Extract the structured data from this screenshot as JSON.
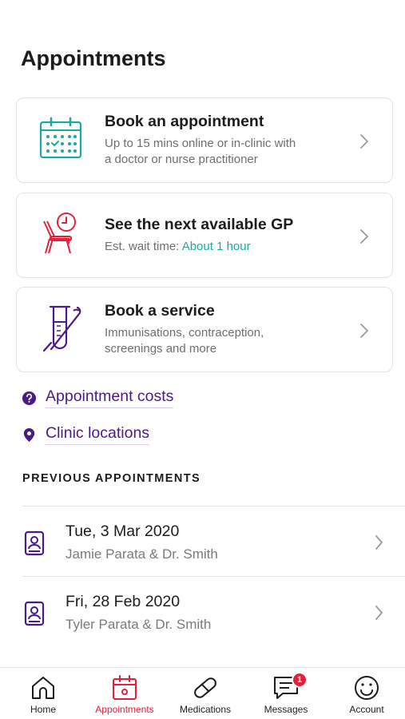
{
  "page": {
    "title": "Appointments"
  },
  "cards": [
    {
      "title": "Book an appointment",
      "subtitle_line1": "Up to 15 mins online or in-clinic with",
      "subtitle_line2": "a doctor or nurse practitioner",
      "icon": "calendar-icon",
      "icon_color": "#1aa8a0"
    },
    {
      "title": "See the next available GP",
      "subtitle_prefix": "Est. wait time: ",
      "subtitle_accent": "About 1 hour",
      "icon": "waiting-chair-clock-icon",
      "icon_color": "#e4213b"
    },
    {
      "title": "Book a service",
      "subtitle_line1": "Immunisations, contraception,",
      "subtitle_line2": "screenings and more",
      "icon": "test-tube-icon",
      "icon_color": "#4b1a86"
    }
  ],
  "links": [
    {
      "label": "Appointment costs",
      "icon": "question-circle-icon"
    },
    {
      "label": "Clinic locations",
      "icon": "location-pin-icon"
    }
  ],
  "previous": {
    "section_label": "PREVIOUS APPOINTMENTS",
    "items": [
      {
        "date": "Tue, 3 Mar 2020",
        "people": "Jamie Parata & Dr. Smith"
      },
      {
        "date": "Fri, 28 Feb 2020",
        "people": "Tyler Parata & Dr. Smith"
      }
    ]
  },
  "tabbar": {
    "tabs": [
      {
        "label": "Home",
        "icon": "home-icon",
        "active": false
      },
      {
        "label": "Appointments",
        "icon": "calendar-icon",
        "active": true
      },
      {
        "label": "Medications",
        "icon": "pill-icon",
        "active": false
      },
      {
        "label": "Messages",
        "icon": "message-icon",
        "active": false,
        "badge": "1"
      },
      {
        "label": "Account",
        "icon": "smiley-icon",
        "active": false
      }
    ]
  },
  "colors": {
    "brand_purple": "#4b1a86",
    "teal": "#1aa8a0",
    "red": "#e4213b"
  }
}
